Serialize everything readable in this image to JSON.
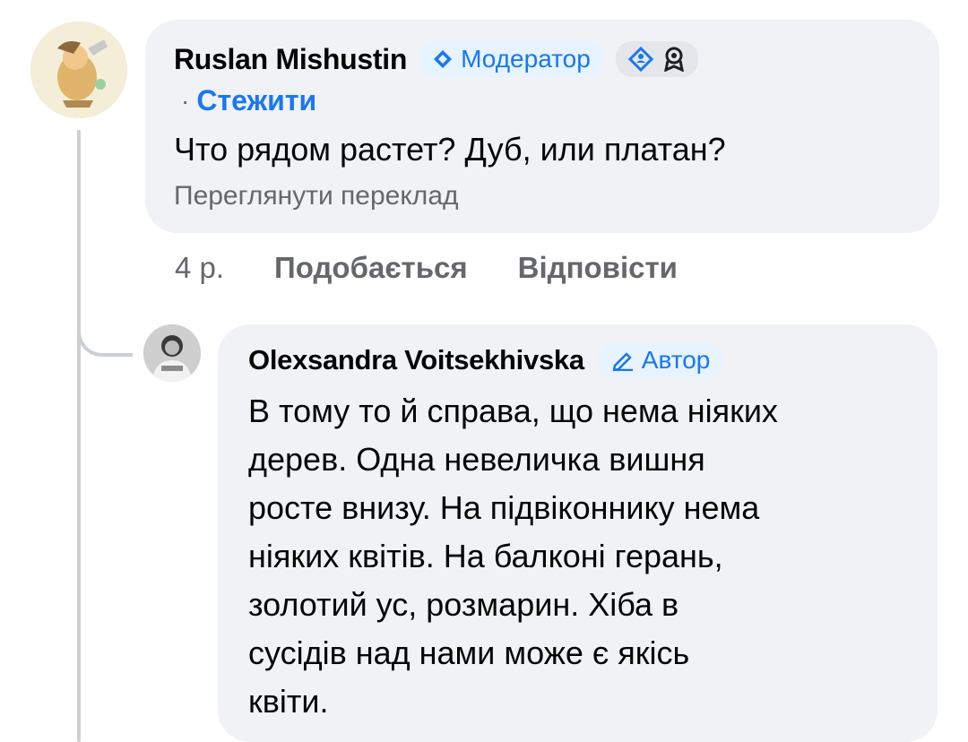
{
  "main_comment": {
    "author": "Ruslan Mishustin",
    "badge_label": "Модератор",
    "follow_separator": "·",
    "follow_label": "Стежити",
    "text": "Что рядом растет? Дуб, или платан?",
    "translate_label": "Переглянути переклад",
    "time": "4 р.",
    "like_label": "Подобається",
    "reply_label": "Відповісти"
  },
  "reply": {
    "author": "Olexsandra Voitsekhivska",
    "badge_label": "Автор",
    "lines": [
      "В тому то й справа, що нема ніяких",
      "дерев. Одна невеличка вишня",
      "росте внизу. На підвіконнику нема",
      "ніяких квітів. На балконі герань,",
      "золотий ус, розмарин. Хіба в",
      "сусідів над нами може є якісь",
      "квіти."
    ]
  },
  "colors": {
    "accent": "#1877f2",
    "bubble": "#f0f2f5",
    "secondary_text": "#65676b"
  }
}
